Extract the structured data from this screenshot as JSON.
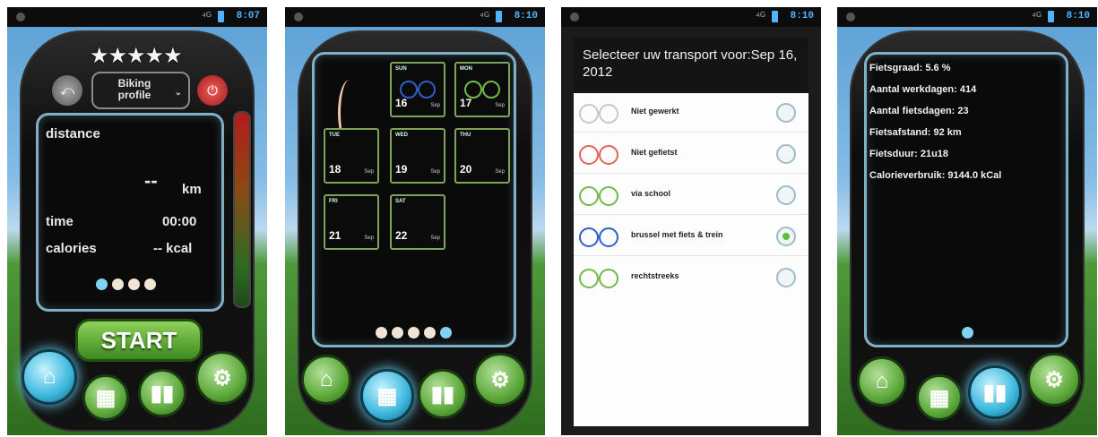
{
  "status": {
    "times": [
      "8:07",
      "8:10",
      "8:10",
      "8:10"
    ]
  },
  "screen1": {
    "stars": "★★★★★",
    "profile_line1": "Biking",
    "profile_line2": "profile",
    "distance_label": "distance",
    "distance_value": "--",
    "distance_unit": "km",
    "time_label": "time",
    "time_value": "00:00",
    "calories_label": "calories",
    "calories_value": "-- kcal",
    "start_label": "START",
    "page_dots": 4,
    "active_dot": 0
  },
  "screen2": {
    "days": [
      {
        "name": "SUN",
        "day": "16",
        "month": "Sep"
      },
      {
        "name": "MON",
        "day": "17",
        "month": "Sep"
      },
      {
        "name": "TUE",
        "day": "18",
        "month": "Sep"
      },
      {
        "name": "WED",
        "day": "19",
        "month": "Sep"
      },
      {
        "name": "THU",
        "day": "20",
        "month": "Sep"
      },
      {
        "name": "FRI",
        "day": "21",
        "month": "Sep"
      },
      {
        "name": "SAT",
        "day": "22",
        "month": "Sep"
      }
    ],
    "page_dots": 5,
    "active_dot": 4
  },
  "screen3": {
    "title": "Selecteer uw transport voor:Sep 16, 2012",
    "options": [
      {
        "label": "Niet gewerkt",
        "color": "#c8c8c8",
        "selected": false
      },
      {
        "label": "Niet gefietst",
        "color": "#e0665a",
        "selected": false
      },
      {
        "label": "via school",
        "color": "#73b84a",
        "selected": false
      },
      {
        "label": "brussel met fiets & trein",
        "color": "#2d5fc4",
        "selected": true
      },
      {
        "label": "rechtstreeks",
        "color": "#73b84a",
        "selected": false
      }
    ]
  },
  "screen4": {
    "stats": [
      "Fietsgraad: 5.6 %",
      "Aantal werkdagen: 414",
      "Aantal fietsdagen: 23",
      "Fietsafstand: 92 km",
      "Fietsduur: 21u18",
      "Calorieverbruik: 9144.0 kCal"
    ]
  },
  "nav": {
    "icons": [
      "home-icon",
      "calendar-icon",
      "stats-icon",
      "settings-icon"
    ]
  },
  "colors": {
    "panel_border": "#7fb0c6",
    "accent_blue": "#3bb7dc",
    "accent_green": "#5ca83a"
  }
}
